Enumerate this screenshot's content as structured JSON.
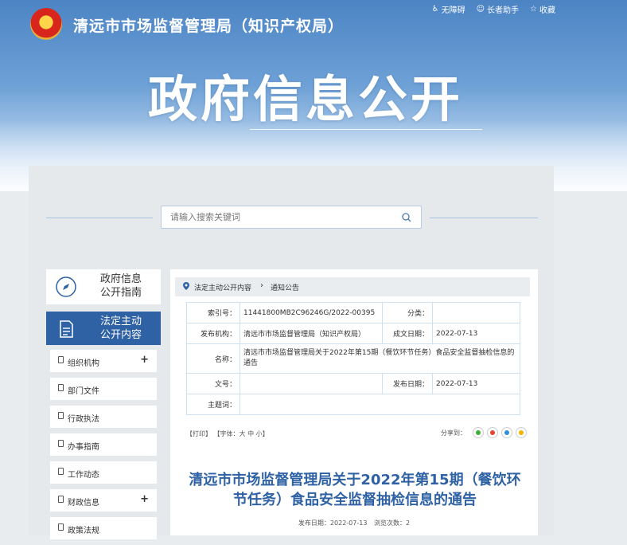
{
  "header": {
    "site_title": "清远市市场监督管理局（知识产权局）",
    "links": [
      {
        "icon": "accessibility-icon",
        "label": "无障碍"
      },
      {
        "icon": "elderly-helper-icon",
        "label": "长者助手"
      },
      {
        "icon": "star-icon",
        "label": "收藏"
      }
    ],
    "banner_title": "政府信息公开"
  },
  "search": {
    "placeholder": "请输入搜索关键词"
  },
  "sidebar": {
    "guide": {
      "line1": "政府信息",
      "line2": "公开指南"
    },
    "active": {
      "line1": "法定主动",
      "line2": "公开内容"
    },
    "items": [
      {
        "label": "组织机构",
        "expandable": true
      },
      {
        "label": "部门文件",
        "expandable": false
      },
      {
        "label": "行政执法",
        "expandable": false
      },
      {
        "label": "办事指南",
        "expandable": false
      },
      {
        "label": "工作动态",
        "expandable": false
      },
      {
        "label": "财政信息",
        "expandable": true
      },
      {
        "label": "政策法规",
        "expandable": false
      }
    ],
    "plus": "+"
  },
  "breadcrumb": {
    "level1": "法定主动公开内容",
    "sep": "›",
    "level2": "通知公告"
  },
  "meta": {
    "index_label": "索引号：",
    "index_value": "11441800MB2C96246G/2022-00395",
    "category_label": "分类：",
    "category_value": "",
    "publisher_label": "发布机构：",
    "publisher_value": "清远市市场监督管理局（知识产权局）",
    "created_label": "成文日期：",
    "created_value": "2022-07-13",
    "name_label": "名称：",
    "name_value": "清远市市场监督管理局关于2022年第15期（餐饮环节任务）食品安全监督抽检信息的通告",
    "docno_label": "文号：",
    "docno_value": "",
    "pubdate_label": "发布日期：",
    "pubdate_value": "2022-07-13",
    "keywords_label": "主题词：",
    "keywords_value": ""
  },
  "tools": {
    "print": "【打印】",
    "font": "【字体：大 中 小】",
    "share_label": "分享到："
  },
  "share_icons": [
    {
      "name": "wechat-share-icon",
      "color": "#3cb035"
    },
    {
      "name": "weibo-share-icon",
      "color": "#e6462e"
    },
    {
      "name": "qq-share-icon",
      "color": "#2f8fdb"
    },
    {
      "name": "qzone-share-icon",
      "color": "#f5b400"
    }
  ],
  "article": {
    "title": "清远市市场监督管理局关于2022年第15期（餐饮环节任务）食品安全监督抽检信息的通告",
    "pubdate": "发布日期：2022-07-13",
    "views": "浏览次数：2"
  }
}
